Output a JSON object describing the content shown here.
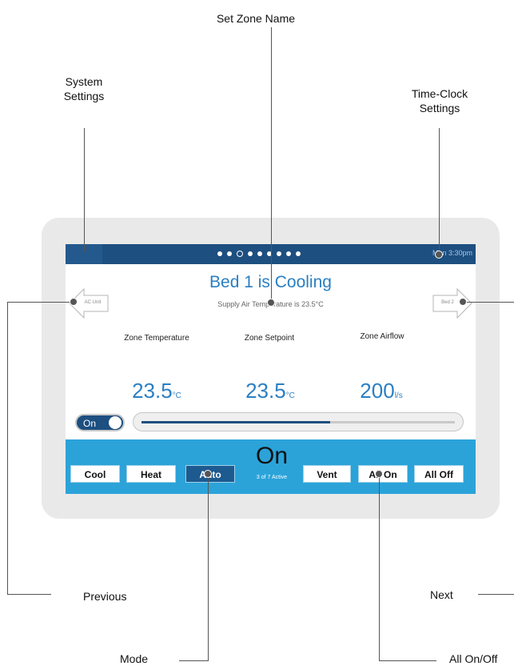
{
  "callouts": {
    "set_zone_name": "Set Zone Name",
    "system_settings_1": "System",
    "system_settings_2": "Settings",
    "time_clock_1": "Time-Clock",
    "time_clock_2": "Settings",
    "previous": "Previous",
    "next": "Next",
    "mode": "Mode",
    "all_on_off": "All On/Off"
  },
  "topbar": {
    "page_count": 9,
    "current_page": 3,
    "clock": "Mon 3:30pm"
  },
  "zone": {
    "title": "Bed 1 is Cooling",
    "supply_text": "Supply Air Temperature is 23.5°C",
    "prev_label": "AC Unit",
    "next_label": "Bed 2"
  },
  "metrics": [
    {
      "label": "Zone Temperature",
      "value": "23.5",
      "unit": "°C"
    },
    {
      "label": "Zone Setpoint",
      "value": "23.5",
      "unit": "°C"
    },
    {
      "label": "Zone Airflow",
      "value": "200",
      "unit": "l/s"
    }
  ],
  "toggle": {
    "label": "On",
    "state": "on"
  },
  "slider": {
    "fraction": 0.6
  },
  "modes": {
    "cool": "Cool",
    "heat": "Heat",
    "auto": "Auto",
    "selected": "Auto",
    "state": "On",
    "active_count": "3 of 7 Active",
    "vent": "Vent",
    "all_on": "All On",
    "all_off": "All Off"
  },
  "colors": {
    "accent": "#2a7fc3",
    "topbar": "#1d4f80",
    "mode_bar": "#2ba3d9"
  }
}
